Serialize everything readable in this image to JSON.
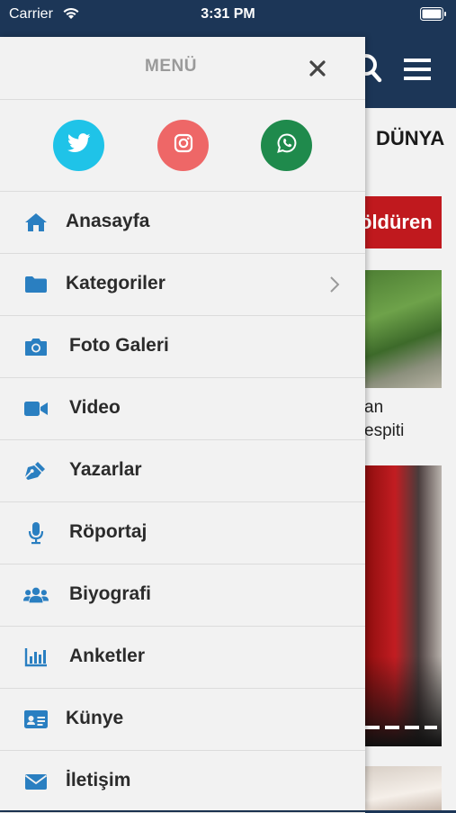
{
  "status_bar": {
    "carrier": "Carrier",
    "time": "3:31 PM"
  },
  "background": {
    "tab_label": "DÜNYA",
    "headline_fragment": "öldüren",
    "caption_line1": "an",
    "caption_line2": "espiti"
  },
  "drawer": {
    "title": "MENÜ",
    "social": [
      {
        "name": "twitter",
        "icon": "twitter-icon",
        "color": "#1fc3e8"
      },
      {
        "name": "instagram",
        "icon": "instagram-icon",
        "color": "#ee6767"
      },
      {
        "name": "whatsapp",
        "icon": "whatsapp-icon",
        "color": "#1f8a4c"
      }
    ],
    "items": [
      {
        "label": "Anasayfa",
        "icon": "home-icon"
      },
      {
        "label": "Kategoriler",
        "icon": "folder-icon",
        "has_chevron": true
      },
      {
        "label": "Foto Galeri",
        "icon": "camera-icon"
      },
      {
        "label": "Video",
        "icon": "video-camera-icon"
      },
      {
        "label": "Yazarlar",
        "icon": "pen-nib-icon"
      },
      {
        "label": "Röportaj",
        "icon": "microphone-icon"
      },
      {
        "label": "Biyografi",
        "icon": "users-icon"
      },
      {
        "label": "Anketler",
        "icon": "bar-chart-icon"
      },
      {
        "label": "Künye",
        "icon": "id-card-icon"
      },
      {
        "label": "İletişim",
        "icon": "envelope-icon"
      }
    ]
  },
  "colors": {
    "navy": "#1c3657",
    "icon_blue": "#2a7fc1",
    "drawer_bg": "#f2f2f2",
    "headline_red": "#c0191e"
  }
}
